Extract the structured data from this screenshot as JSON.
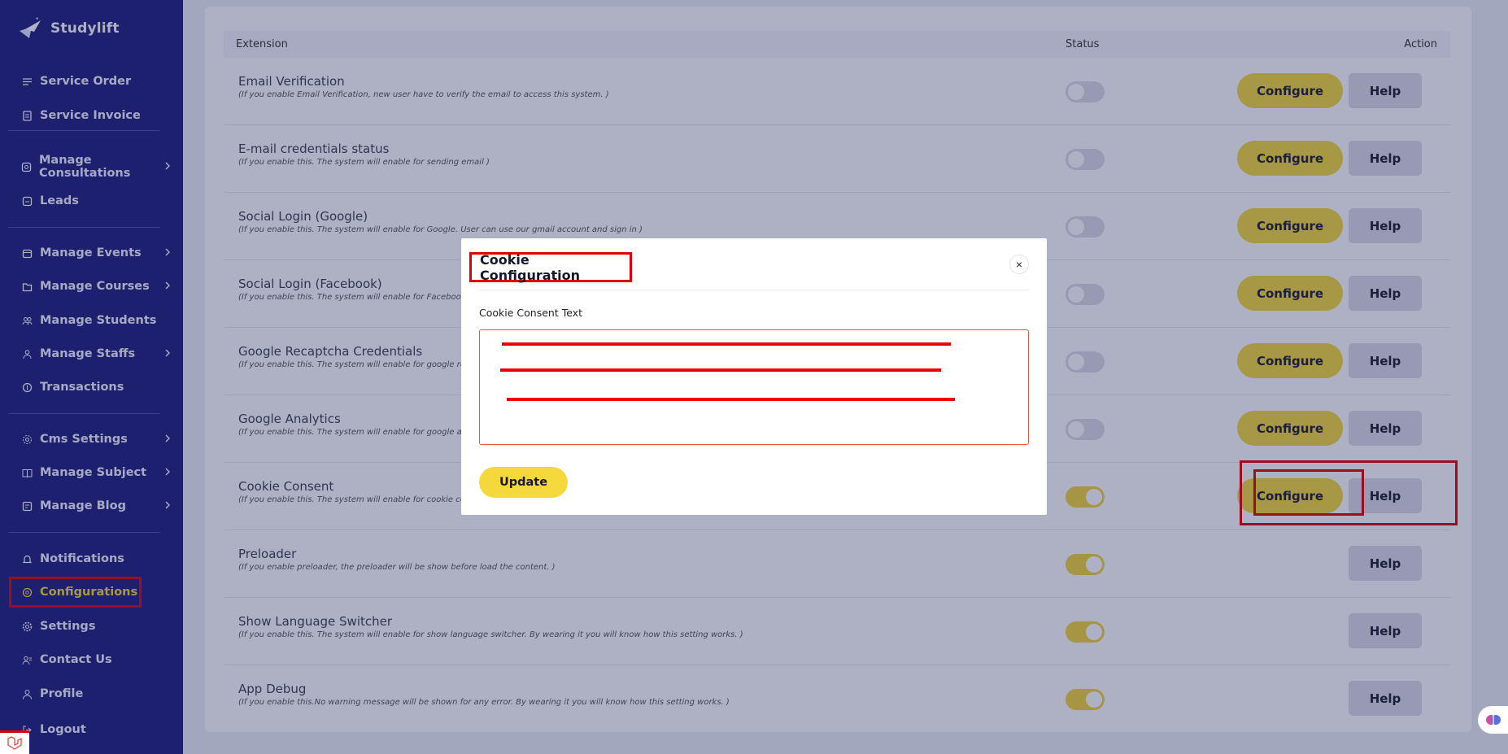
{
  "brand": {
    "name": "Studylift"
  },
  "sidebar": {
    "items": [
      {
        "label": "Service Order",
        "icon": "list-icon"
      },
      {
        "label": "Service Invoice",
        "icon": "invoice-icon"
      },
      {
        "label": "Manage Consultations",
        "icon": "consultation-icon"
      },
      {
        "label": "Leads",
        "icon": "leads-icon"
      },
      {
        "label": "Manage Events",
        "icon": "calendar-icon"
      },
      {
        "label": "Manage Courses",
        "icon": "courses-icon"
      },
      {
        "label": "Manage Students",
        "icon": "students-icon"
      },
      {
        "label": "Manage Staffs",
        "icon": "staff-icon"
      },
      {
        "label": "Transactions",
        "icon": "transactions-icon"
      },
      {
        "label": "Cms Settings",
        "icon": "cms-icon"
      },
      {
        "label": "Manage Subject",
        "icon": "subject-icon"
      },
      {
        "label": "Manage Blog",
        "icon": "blog-icon"
      },
      {
        "label": "Notifications",
        "icon": "bell-icon"
      },
      {
        "label": "Configurations",
        "icon": "config-icon"
      },
      {
        "label": "Settings",
        "icon": "gear-icon"
      },
      {
        "label": "Contact Us",
        "icon": "contact-icon"
      },
      {
        "label": "Profile",
        "icon": "user-icon"
      },
      {
        "label": "Logout",
        "icon": "logout-icon"
      }
    ]
  },
  "table": {
    "headers": {
      "extension": "Extension",
      "status": "Status",
      "action": "Action"
    },
    "configure_label": "Configure",
    "help_label": "Help",
    "rows": [
      {
        "title": "Email Verification",
        "desc": "(If you enable Email Verification, new user have to verify the email to access this system. )",
        "status": "off"
      },
      {
        "title": "E-mail credentials status",
        "desc": "(If you enable this. The system will enable for sending email )",
        "status": "off"
      },
      {
        "title": "Social Login (Google)",
        "desc": "(If you enable this. The system will enable for Google. User can use our gmail account and sign in )",
        "status": "off"
      },
      {
        "title": "Social Login (Facebook)",
        "desc": "(If you enable this. The system will enable for Facebook. U",
        "status": "off"
      },
      {
        "title": "Google Recaptcha Credentials",
        "desc": "(If you enable this. The system will enable for google recap",
        "status": "off"
      },
      {
        "title": "Google Analytics",
        "desc": "(If you enable this. The system will enable for google anal",
        "status": "off"
      },
      {
        "title": "Cookie Consent",
        "desc": "(If you enable this. The system will enable for cookie cons",
        "status": "on"
      },
      {
        "title": "Preloader",
        "desc": "(If you enable preloader, the preloader will be show before load the content. )",
        "status": "on"
      },
      {
        "title": "Show Language Switcher",
        "desc": "(If you enable this. The system will enable for show language switcher. By wearing it you will know how this setting works. )",
        "status": "on"
      },
      {
        "title": "App Debug",
        "desc": "(If you enable this.No warning message will be shown for any error. By wearing it you will know how this setting works. )",
        "status": "on"
      }
    ]
  },
  "modal": {
    "title": "Cookie Configuration",
    "close_symbol": "×",
    "field_label": "Cookie Consent Text",
    "update_label": "Update"
  },
  "colors": {
    "sidebar_bg": "#1b1d7c",
    "accent_yellow": "#f5d83b",
    "highlight_red": "#e00000"
  }
}
